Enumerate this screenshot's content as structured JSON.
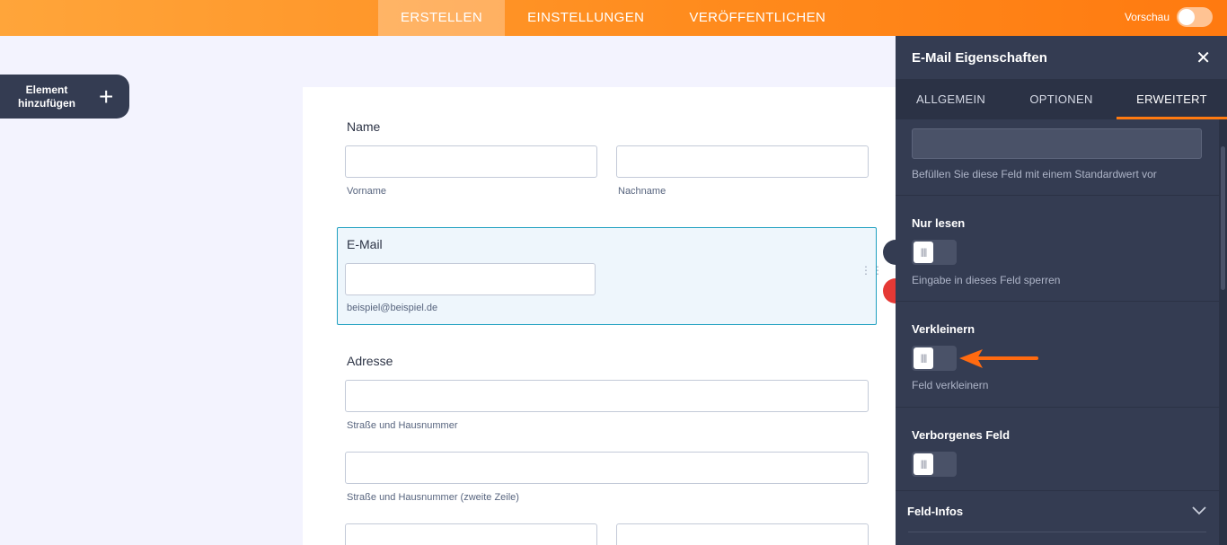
{
  "topbar": {
    "tabs": [
      {
        "label": "ERSTELLEN",
        "active": true
      },
      {
        "label": "EINSTELLUNGEN",
        "active": false
      },
      {
        "label": "VERÖFFENTLICHEN",
        "active": false
      }
    ],
    "preview_label": "Vorschau"
  },
  "add_element": {
    "label": "Element hinzufügen",
    "icon": "plus-icon"
  },
  "form": {
    "name": {
      "label": "Name",
      "first_sub": "Vorname",
      "last_sub": "Nachname"
    },
    "email": {
      "label": "E-Mail",
      "sub": "beispiel@beispiel.de"
    },
    "address": {
      "label": "Adresse",
      "line1_sub": "Straße und Hausnummer",
      "line2_sub": "Straße und Hausnummer (zweite Zeile)"
    }
  },
  "panel": {
    "title": "E-Mail Eigenschaften",
    "tabs": [
      {
        "label": "ALLGEMEIN",
        "active": false
      },
      {
        "label": "OPTIONEN",
        "active": false
      },
      {
        "label": "ERWEITERT",
        "active": true
      }
    ],
    "default_hint": "Befüllen Sie diese Feld mit einem Standardwert vor",
    "readonly": {
      "title": "Nur lesen",
      "hint": "Eingabe in dieses Feld sperren"
    },
    "shrink": {
      "title": "Verkleinern",
      "hint": "Feld verkleinern"
    },
    "hidden": {
      "title": "Verborgenes Feld"
    },
    "field_info": {
      "title": "Feld-Infos"
    }
  },
  "colors": {
    "accent": "#ff7a10",
    "panel": "#343c52",
    "selection": "#1fa0c0",
    "delete": "#e53935"
  }
}
